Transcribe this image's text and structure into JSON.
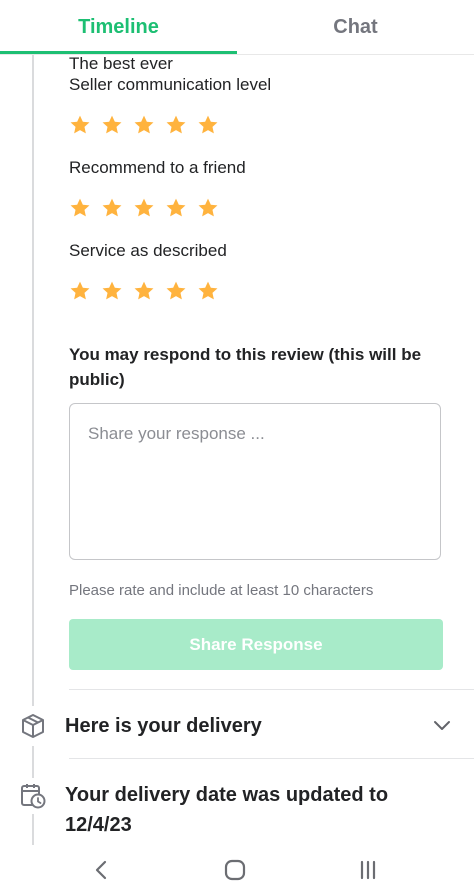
{
  "tabs": [
    {
      "label": "Timeline",
      "active": true
    },
    {
      "label": "Chat",
      "active": false
    }
  ],
  "review": {
    "overall_text": "The best ever",
    "ratings": [
      {
        "label": "Seller communication level",
        "stars": 5
      },
      {
        "label": "Recommend to a friend",
        "stars": 5
      },
      {
        "label": "Service as described",
        "stars": 5
      }
    ]
  },
  "response": {
    "prompt": "You may respond to this review (this will be public)",
    "placeholder": "Share your response ...",
    "hint": "Please rate and include at least 10 characters",
    "button_label": "Share Response"
  },
  "events": [
    {
      "title": "Here is your delivery",
      "icon": "package-icon",
      "expandable": true
    },
    {
      "title": "Your delivery date was updated to 12/4/23",
      "icon": "calendar-clock-icon",
      "expandable": false
    }
  ],
  "colors": {
    "accent": "#1dbf73",
    "star": "#ffb33e",
    "button_disabled": "#a8ebc9"
  },
  "navbar": [
    "back-icon",
    "home-icon",
    "recents-icon"
  ]
}
